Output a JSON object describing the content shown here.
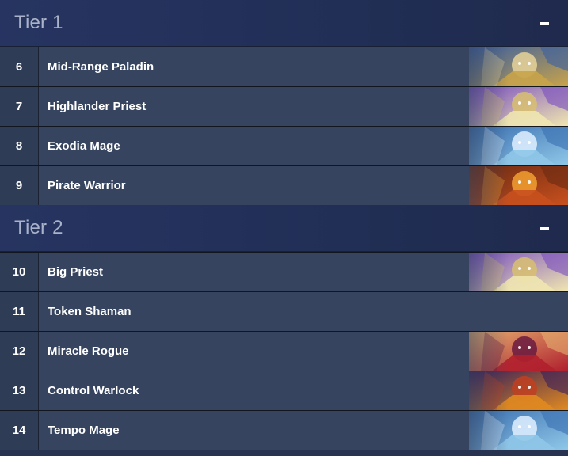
{
  "tiers": [
    {
      "title": "Tier 1",
      "collapse_symbol": "−",
      "decks": [
        {
          "rank": "6",
          "name": "Mid-Range Paladin",
          "art": "paladin-portrait-icon",
          "colors": [
            "#c8a34a",
            "#3b5fa0",
            "#e8d49a"
          ]
        },
        {
          "rank": "7",
          "name": "Highlander Priest",
          "art": "priest-portrait-icon",
          "colors": [
            "#f0e6b0",
            "#7a4fc0",
            "#d8c070"
          ]
        },
        {
          "rank": "8",
          "name": "Exodia Mage",
          "art": "mage-portrait-icon",
          "colors": [
            "#8fc7e8",
            "#3a6fb0",
            "#e0f0ff"
          ]
        },
        {
          "rank": "9",
          "name": "Pirate Warrior",
          "art": "warrior-portrait-icon",
          "colors": [
            "#c8501e",
            "#6b2a12",
            "#f2a030"
          ]
        }
      ]
    },
    {
      "title": "Tier 2",
      "collapse_symbol": "−",
      "decks": [
        {
          "rank": "10",
          "name": "Big Priest",
          "art": "priest-portrait-icon",
          "colors": [
            "#f0e6b0",
            "#7a4fc0",
            "#d8c070"
          ]
        },
        {
          "rank": "11",
          "name": "Token Shaman",
          "art": "",
          "colors": []
        },
        {
          "rank": "12",
          "name": "Miracle Rogue",
          "art": "rogue-portrait-icon",
          "colors": [
            "#b0202e",
            "#e6b070",
            "#6a1a40"
          ]
        },
        {
          "rank": "13",
          "name": "Control Warlock",
          "art": "warlock-portrait-icon",
          "colors": [
            "#e08a20",
            "#3a1e5a",
            "#c04020"
          ]
        },
        {
          "rank": "14",
          "name": "Tempo Mage",
          "art": "mage-portrait-icon",
          "colors": [
            "#8fc7e8",
            "#3a6fb0",
            "#e0f0ff"
          ]
        }
      ]
    }
  ]
}
